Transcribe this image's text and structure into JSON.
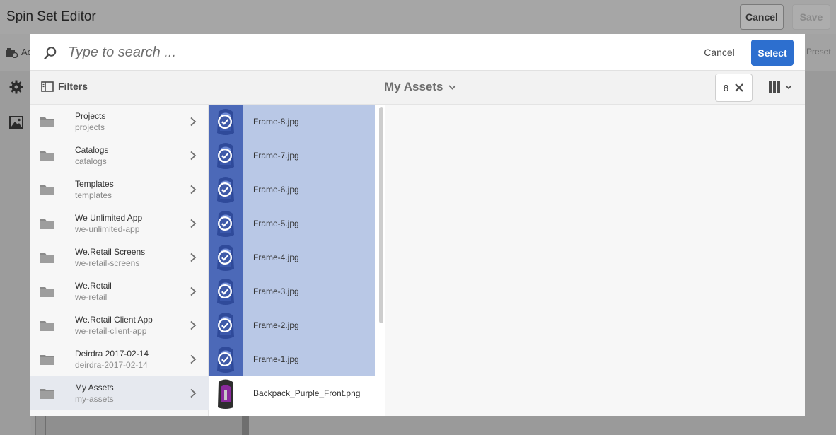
{
  "editor": {
    "title": "Spin Set Editor",
    "cancel_label": "Cancel",
    "save_label": "Save",
    "toolbar_partial_label": "Ac",
    "preset_partial_label": "Preset"
  },
  "picker": {
    "search": {
      "placeholder": "Type to search ...",
      "value": ""
    },
    "cancel_label": "Cancel",
    "select_label": "Select",
    "filters_label": "Filters",
    "location_label": "My Assets",
    "selection_count": "8",
    "folders": [
      {
        "title": "Projects",
        "name": "projects",
        "active": false
      },
      {
        "title": "Catalogs",
        "name": "catalogs",
        "active": false
      },
      {
        "title": "Templates",
        "name": "templates",
        "active": false
      },
      {
        "title": "We Unlimited App",
        "name": "we-unlimited-app",
        "active": false
      },
      {
        "title": "We.Retail Screens",
        "name": "we-retail-screens",
        "active": false
      },
      {
        "title": "We.Retail",
        "name": "we-retail",
        "active": false
      },
      {
        "title": "We.Retail Client App",
        "name": "we-retail-client-app",
        "active": false
      },
      {
        "title": "Deirdra 2017-02-14",
        "name": "deirdra-2017-02-14",
        "active": false
      },
      {
        "title": "My Assets",
        "name": "my-assets",
        "active": true
      }
    ],
    "assets": [
      {
        "name": "Frame-8.jpg",
        "selected": true
      },
      {
        "name": "Frame-7.jpg",
        "selected": true
      },
      {
        "name": "Frame-6.jpg",
        "selected": true
      },
      {
        "name": "Frame-5.jpg",
        "selected": true
      },
      {
        "name": "Frame-4.jpg",
        "selected": true
      },
      {
        "name": "Frame-3.jpg",
        "selected": true
      },
      {
        "name": "Frame-2.jpg",
        "selected": true
      },
      {
        "name": "Frame-1.jpg",
        "selected": true
      },
      {
        "name": "Backpack_Purple_Front.png",
        "selected": false
      }
    ]
  },
  "colors": {
    "accent": "#2d6fcf",
    "selected_row": "#b9c8e6",
    "active_folder": "#e6e9ef"
  }
}
